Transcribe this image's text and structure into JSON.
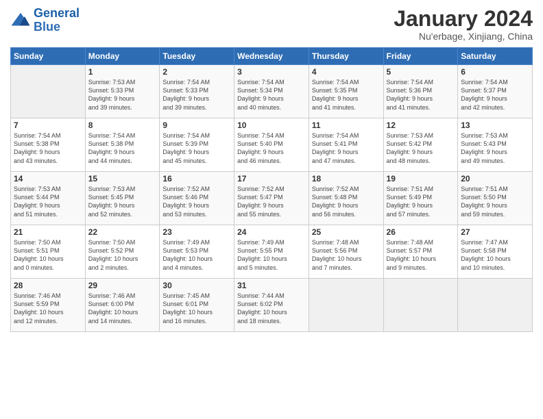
{
  "logo": {
    "line1": "General",
    "line2": "Blue"
  },
  "title": "January 2024",
  "subtitle": "Nu'erbage, Xinjiang, China",
  "days_of_week": [
    "Sunday",
    "Monday",
    "Tuesday",
    "Wednesday",
    "Thursday",
    "Friday",
    "Saturday"
  ],
  "weeks": [
    [
      {
        "num": "",
        "info": ""
      },
      {
        "num": "1",
        "info": "Sunrise: 7:53 AM\nSunset: 5:33 PM\nDaylight: 9 hours\nand 39 minutes."
      },
      {
        "num": "2",
        "info": "Sunrise: 7:54 AM\nSunset: 5:33 PM\nDaylight: 9 hours\nand 39 minutes."
      },
      {
        "num": "3",
        "info": "Sunrise: 7:54 AM\nSunset: 5:34 PM\nDaylight: 9 hours\nand 40 minutes."
      },
      {
        "num": "4",
        "info": "Sunrise: 7:54 AM\nSunset: 5:35 PM\nDaylight: 9 hours\nand 41 minutes."
      },
      {
        "num": "5",
        "info": "Sunrise: 7:54 AM\nSunset: 5:36 PM\nDaylight: 9 hours\nand 41 minutes."
      },
      {
        "num": "6",
        "info": "Sunrise: 7:54 AM\nSunset: 5:37 PM\nDaylight: 9 hours\nand 42 minutes."
      }
    ],
    [
      {
        "num": "7",
        "info": "Sunrise: 7:54 AM\nSunset: 5:38 PM\nDaylight: 9 hours\nand 43 minutes."
      },
      {
        "num": "8",
        "info": "Sunrise: 7:54 AM\nSunset: 5:38 PM\nDaylight: 9 hours\nand 44 minutes."
      },
      {
        "num": "9",
        "info": "Sunrise: 7:54 AM\nSunset: 5:39 PM\nDaylight: 9 hours\nand 45 minutes."
      },
      {
        "num": "10",
        "info": "Sunrise: 7:54 AM\nSunset: 5:40 PM\nDaylight: 9 hours\nand 46 minutes."
      },
      {
        "num": "11",
        "info": "Sunrise: 7:54 AM\nSunset: 5:41 PM\nDaylight: 9 hours\nand 47 minutes."
      },
      {
        "num": "12",
        "info": "Sunrise: 7:53 AM\nSunset: 5:42 PM\nDaylight: 9 hours\nand 48 minutes."
      },
      {
        "num": "13",
        "info": "Sunrise: 7:53 AM\nSunset: 5:43 PM\nDaylight: 9 hours\nand 49 minutes."
      }
    ],
    [
      {
        "num": "14",
        "info": "Sunrise: 7:53 AM\nSunset: 5:44 PM\nDaylight: 9 hours\nand 51 minutes."
      },
      {
        "num": "15",
        "info": "Sunrise: 7:53 AM\nSunset: 5:45 PM\nDaylight: 9 hours\nand 52 minutes."
      },
      {
        "num": "16",
        "info": "Sunrise: 7:52 AM\nSunset: 5:46 PM\nDaylight: 9 hours\nand 53 minutes."
      },
      {
        "num": "17",
        "info": "Sunrise: 7:52 AM\nSunset: 5:47 PM\nDaylight: 9 hours\nand 55 minutes."
      },
      {
        "num": "18",
        "info": "Sunrise: 7:52 AM\nSunset: 5:48 PM\nDaylight: 9 hours\nand 56 minutes."
      },
      {
        "num": "19",
        "info": "Sunrise: 7:51 AM\nSunset: 5:49 PM\nDaylight: 9 hours\nand 57 minutes."
      },
      {
        "num": "20",
        "info": "Sunrise: 7:51 AM\nSunset: 5:50 PM\nDaylight: 9 hours\nand 59 minutes."
      }
    ],
    [
      {
        "num": "21",
        "info": "Sunrise: 7:50 AM\nSunset: 5:51 PM\nDaylight: 10 hours\nand 0 minutes."
      },
      {
        "num": "22",
        "info": "Sunrise: 7:50 AM\nSunset: 5:52 PM\nDaylight: 10 hours\nand 2 minutes."
      },
      {
        "num": "23",
        "info": "Sunrise: 7:49 AM\nSunset: 5:53 PM\nDaylight: 10 hours\nand 4 minutes."
      },
      {
        "num": "24",
        "info": "Sunrise: 7:49 AM\nSunset: 5:55 PM\nDaylight: 10 hours\nand 5 minutes."
      },
      {
        "num": "25",
        "info": "Sunrise: 7:48 AM\nSunset: 5:56 PM\nDaylight: 10 hours\nand 7 minutes."
      },
      {
        "num": "26",
        "info": "Sunrise: 7:48 AM\nSunset: 5:57 PM\nDaylight: 10 hours\nand 9 minutes."
      },
      {
        "num": "27",
        "info": "Sunrise: 7:47 AM\nSunset: 5:58 PM\nDaylight: 10 hours\nand 10 minutes."
      }
    ],
    [
      {
        "num": "28",
        "info": "Sunrise: 7:46 AM\nSunset: 5:59 PM\nDaylight: 10 hours\nand 12 minutes."
      },
      {
        "num": "29",
        "info": "Sunrise: 7:46 AM\nSunset: 6:00 PM\nDaylight: 10 hours\nand 14 minutes."
      },
      {
        "num": "30",
        "info": "Sunrise: 7:45 AM\nSunset: 6:01 PM\nDaylight: 10 hours\nand 16 minutes."
      },
      {
        "num": "31",
        "info": "Sunrise: 7:44 AM\nSunset: 6:02 PM\nDaylight: 10 hours\nand 18 minutes."
      },
      {
        "num": "",
        "info": ""
      },
      {
        "num": "",
        "info": ""
      },
      {
        "num": "",
        "info": ""
      }
    ]
  ]
}
